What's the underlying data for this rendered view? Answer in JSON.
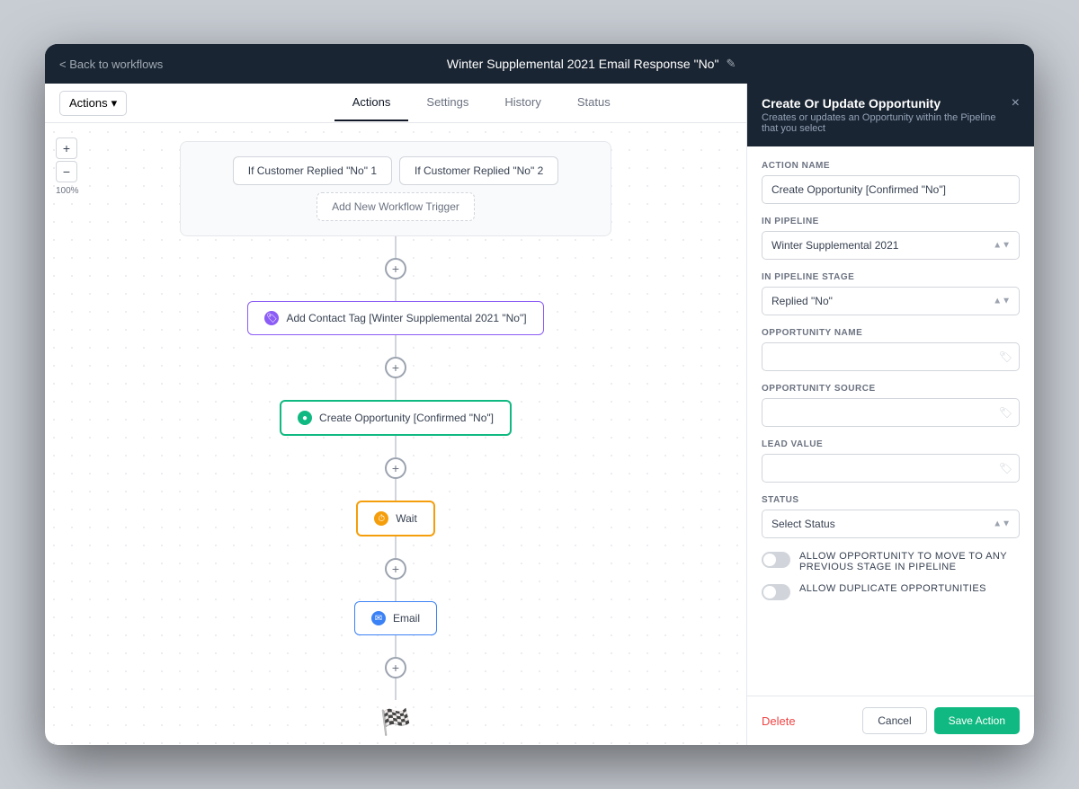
{
  "app": {
    "back_label": "< Back to workflows",
    "title": "Winter Supplemental 2021 Email Response \"No\"",
    "edit_icon": "✎"
  },
  "tabs": [
    {
      "id": "actions",
      "label": "Actions",
      "active": true
    },
    {
      "id": "settings",
      "label": "Settings",
      "active": false
    },
    {
      "id": "history",
      "label": "History",
      "active": false
    },
    {
      "id": "status",
      "label": "Status",
      "active": false
    }
  ],
  "toolbar": {
    "actions_label": "Actions",
    "actions_arrow": "▾"
  },
  "canvas": {
    "zoom_in_label": "+",
    "zoom_out_label": "−",
    "zoom_level": "100%",
    "triggers": [
      {
        "label": "If Customer Replied \"No\" 1"
      },
      {
        "label": "If Customer Replied \"No\" 2"
      }
    ],
    "add_trigger_label": "Add New Workflow Trigger",
    "nodes": [
      {
        "id": "tag-node",
        "type": "tag",
        "label": "Add Contact Tag [Winter Supplemental 2021 \"No\"]",
        "icon_type": "purple"
      },
      {
        "id": "opportunity-node",
        "type": "opportunity",
        "label": "Create Opportunity [Confirmed \"No\"]",
        "icon_type": "green"
      },
      {
        "id": "wait-node",
        "type": "wait",
        "label": "Wait",
        "icon_type": "orange"
      },
      {
        "id": "email-node",
        "type": "email",
        "label": "Email",
        "icon_type": "blue"
      }
    ],
    "finish_icon": "🏁"
  },
  "right_panel": {
    "title": "Create Or Update Opportunity",
    "subtitle": "Creates or updates an Opportunity within the Pipeline that you select",
    "close_icon": "×",
    "fields": {
      "action_name_label": "ACTION NAME",
      "action_name_value": "Create Opportunity [Confirmed \"No\"]",
      "action_name_placeholder": "",
      "in_pipeline_label": "IN PIPELINE",
      "in_pipeline_value": "Winter Supplemental 2021",
      "in_pipeline_options": [
        "Winter Supplemental 2021"
      ],
      "in_pipeline_stage_label": "IN PIPELINE STAGE",
      "in_pipeline_stage_value": "Replied \"No\"",
      "in_pipeline_stage_options": [
        "Replied \"No\""
      ],
      "opportunity_name_label": "OPPORTUNITY NAME",
      "opportunity_name_value": "",
      "opportunity_name_placeholder": "",
      "opportunity_source_label": "OPPORTUNITY SOURCE",
      "opportunity_source_value": "",
      "opportunity_source_placeholder": "",
      "lead_value_label": "LEAD VALUE",
      "lead_value_value": "",
      "lead_value_placeholder": "",
      "status_label": "STATUS",
      "status_value": "Select Status",
      "status_options": [
        "Select Status"
      ],
      "toggle1_label": "ALLOW OPPORTUNITY TO MOVE TO ANY PREVIOUS STAGE IN PIPELINE",
      "toggle2_label": "ALLOW DUPLICATE OPPORTUNITIES"
    },
    "footer": {
      "delete_label": "Delete",
      "cancel_label": "Cancel",
      "save_label": "Save Action"
    }
  }
}
